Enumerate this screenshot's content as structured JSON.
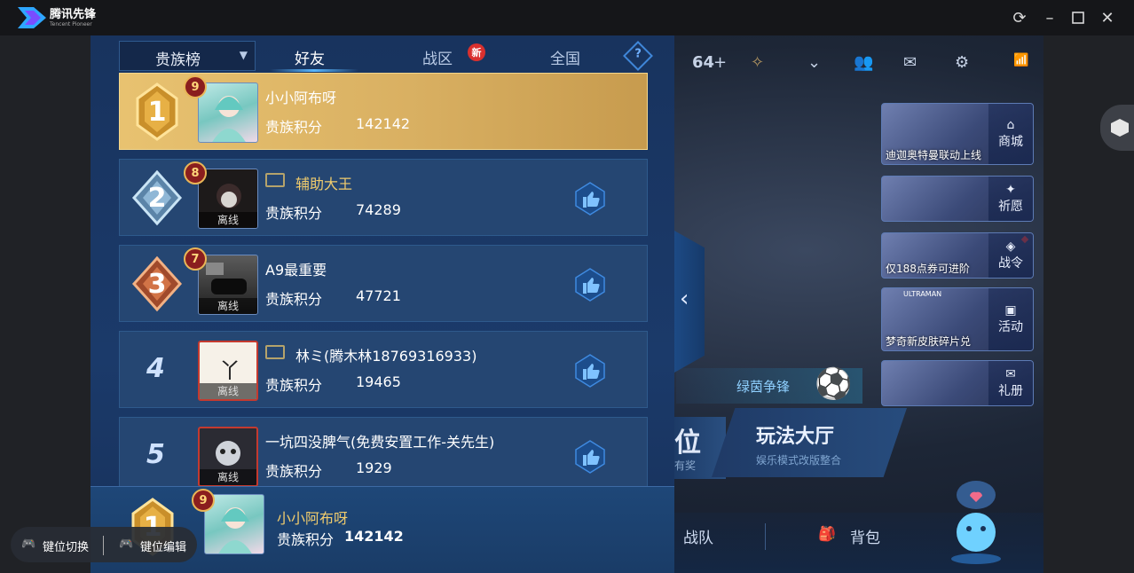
{
  "window": {
    "app_name": "腾讯先锋",
    "app_sub": "Tencent Pioneer",
    "controls": [
      "refresh",
      "minimize",
      "maximize",
      "close"
    ]
  },
  "panel": {
    "tab_select_label": "贵族榜",
    "tabs": [
      {
        "label": "好友",
        "active": true
      },
      {
        "label": "战区",
        "badge": "新"
      },
      {
        "label": "全国"
      }
    ],
    "help": "?",
    "score_label": "贵族积分",
    "offline_label": "离线"
  },
  "rows": [
    {
      "rank": "1",
      "vip": "9",
      "name": "小小阿布呀",
      "score": "142142",
      "offline": false,
      "highlight": true
    },
    {
      "rank": "2",
      "vip": "8",
      "name": "辅助大王",
      "score": "74289",
      "offline": true,
      "has_tag": true
    },
    {
      "rank": "3",
      "vip": "7",
      "name": "A9最重要",
      "score": "47721",
      "offline": true
    },
    {
      "rank": "4",
      "vip": "",
      "name": "林ミ(腾木林18769316933)",
      "score": "19465",
      "offline": true,
      "has_tag": true
    },
    {
      "rank": "5",
      "vip": "",
      "name": "一坑四没脾气(免费安置工作-关先生)",
      "score": "1929",
      "offline": true
    }
  ],
  "my_row": {
    "rank": "1",
    "vip": "9",
    "name": "小小阿布呀",
    "score_label": "贵族积分",
    "score": "142142"
  },
  "lobby": {
    "topbar_count": "64",
    "promos": [
      {
        "side": "商城",
        "caption": "迪迦奥特曼联动上线"
      },
      {
        "side": "祈愿",
        "caption": ""
      },
      {
        "side": "战令",
        "caption": "仅188点券可进阶"
      },
      {
        "side": "活动",
        "caption": "梦奇新皮肤碎片兑",
        "tag": "ULTRAMAN"
      },
      {
        "side": "礼册",
        "caption": ""
      }
    ],
    "green_button": "绿茵争锋",
    "mode_prefix": "位",
    "mode_prefix_sub": "有奖",
    "mode_title": "玩法大厅",
    "mode_sub": "娱乐模式改版整合",
    "nav": [
      "战队",
      "背包"
    ]
  },
  "toolbar": {
    "switch_label": "键位切换",
    "edit_label": "键位编辑"
  },
  "colors": {
    "panel_bg": "#18335e",
    "gold_row": "#e8c270",
    "accent_blue": "#58b7ff",
    "name_gold": "#f0cc6d"
  }
}
